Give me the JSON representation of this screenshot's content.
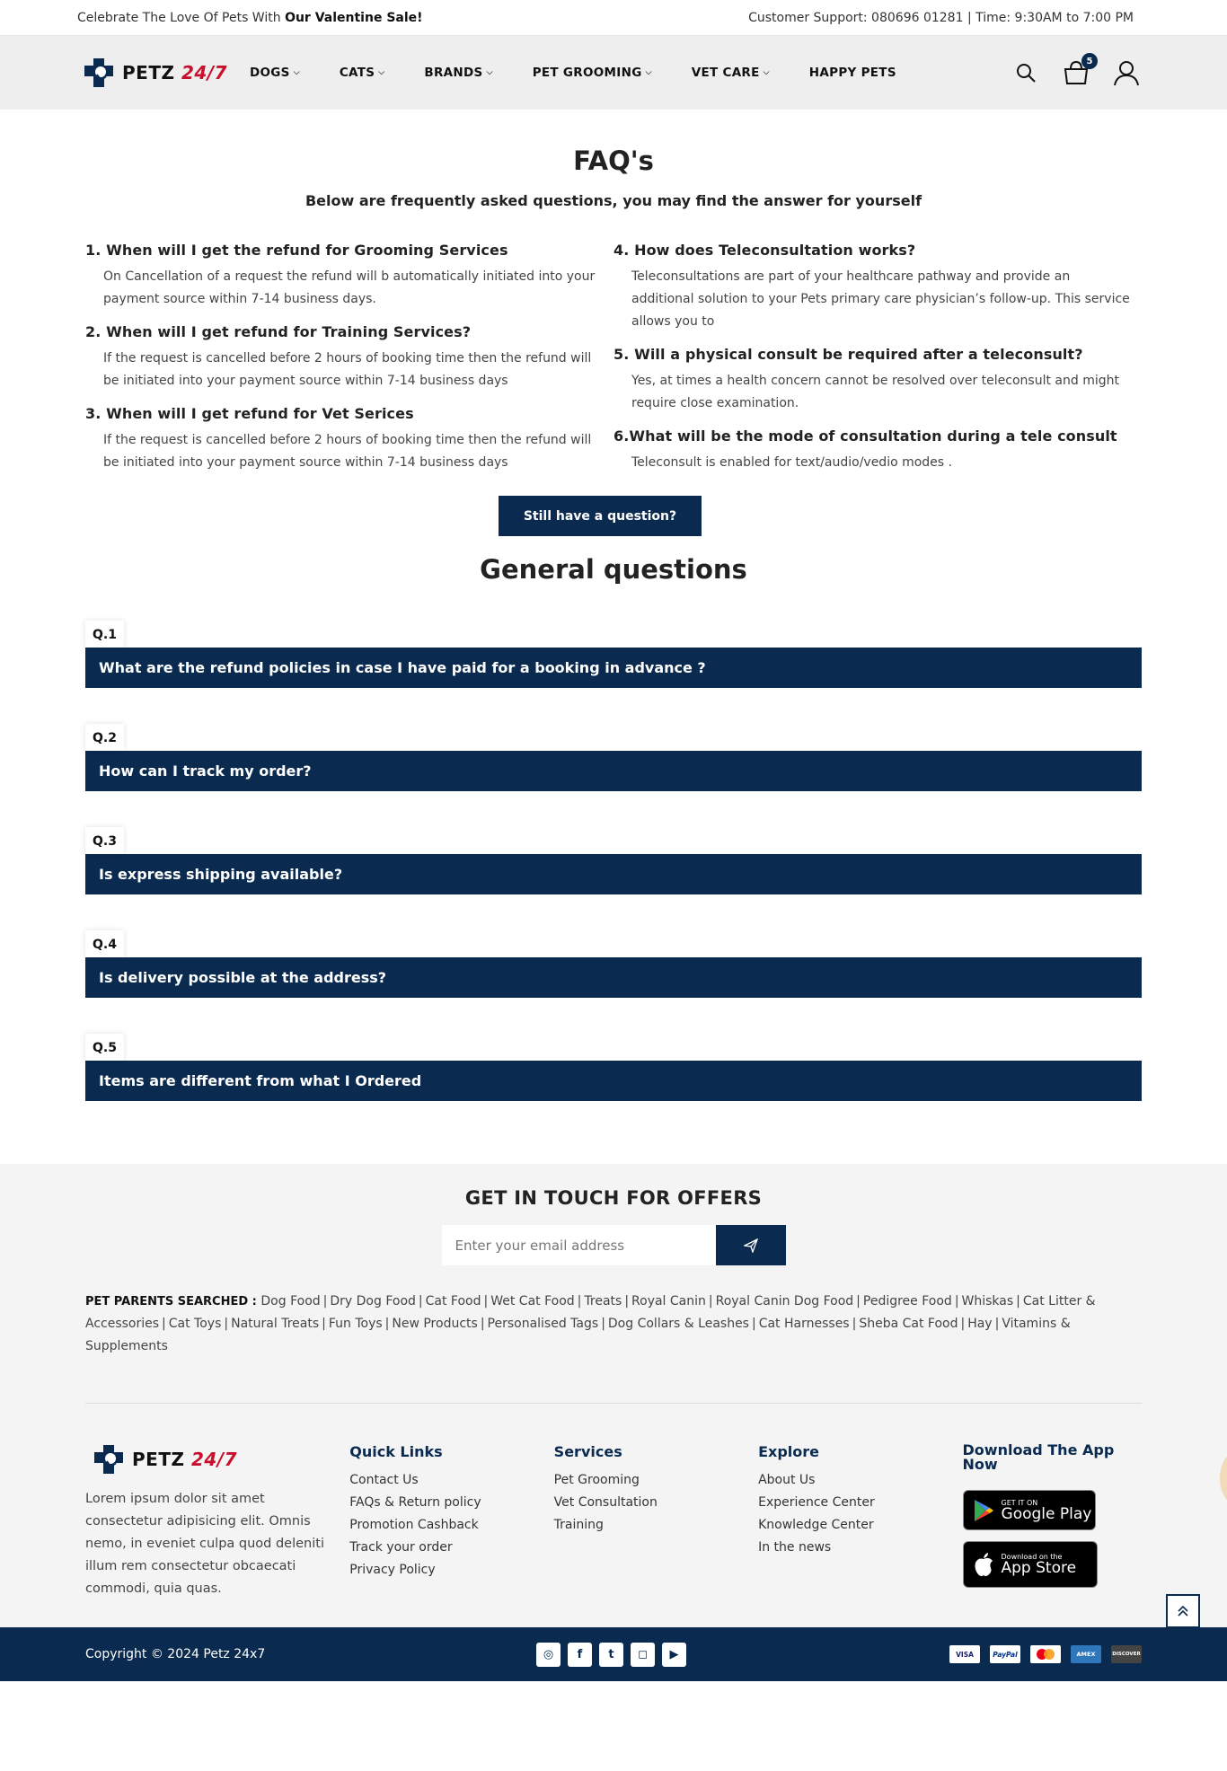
{
  "topbar": {
    "promo_prefix": "Celebrate The Love Of Pets With ",
    "promo_bold": "Our Valentine Sale!",
    "support": "Customer Support: 080696 01281 | Time: 9:30AM to 7:00 PM"
  },
  "logo": {
    "text": "PETZ ",
    "accent": "24/7"
  },
  "nav": [
    {
      "label": "DOGS",
      "dropdown": true
    },
    {
      "label": "CATS",
      "dropdown": true
    },
    {
      "label": "BRANDS",
      "dropdown": true
    },
    {
      "label": "PET GROOMING",
      "dropdown": true
    },
    {
      "label": "VET CARE",
      "dropdown": true
    },
    {
      "label": "HAPPY PETS",
      "dropdown": false
    }
  ],
  "cart": {
    "count": "5"
  },
  "faq": {
    "title": "FAQ's",
    "subtitle": "Below are frequently asked questions, you may find the answer for yourself",
    "left": [
      {
        "q": "1. When will I get the refund for Grooming Services",
        "a": "On Cancellation of a request the refund will b automatically initiated into your payment source within 7-14 business days."
      },
      {
        "q": "2. When will I get refund for Training Services?",
        "a": "If the request is cancelled before 2 hours of booking time then the refund will be initiated into your payment source within 7-14 business days"
      },
      {
        "q": "3. When will I get refund for Vet Serices",
        "a": "If the request is cancelled before 2 hours of booking time then the refund will be initiated into your payment source within 7-14 business days"
      }
    ],
    "right": [
      {
        "q": "4. How does Teleconsultation works?",
        "a": "Teleconsultations are part of your healthcare pathway and provide an additional solution to your Pets primary care physician’s follow-up. This service allows you to"
      },
      {
        "q": "5. Will a physical consult be required after a teleconsult?",
        "a": "Yes, at times a health concern cannot be resolved over teleconsult and might require close examination."
      },
      {
        "q": "6.What will be the mode of consultation during a tele consult",
        "a": "Teleconsult is enabled for text/audio/vedio modes ."
      }
    ],
    "still_button": "Still have a question?"
  },
  "general": {
    "title": "General questions",
    "items": [
      {
        "num": "Q.1",
        "q": "What are the refund policies in case I have paid for a booking in advance ?"
      },
      {
        "num": "Q.2",
        "q": "How can I track my order?"
      },
      {
        "num": "Q.3",
        "q": "Is express shipping available?"
      },
      {
        "num": "Q.4",
        "q": "Is delivery possible at the address?"
      },
      {
        "num": "Q.5",
        "q": "Items are different from what I Ordered"
      }
    ]
  },
  "newsletter": {
    "title": "GET IN TOUCH FOR OFFERS",
    "placeholder": "Enter your email address"
  },
  "searched": {
    "label": "PET PARENTS SEARCHED : ",
    "links": [
      "Dog Food",
      "Dry Dog Food",
      "Cat Food",
      "Wet Cat Food",
      "Treats",
      "Royal Canin",
      "Royal Canin Dog Food",
      "Pedigree Food",
      "Whiskas",
      "Cat Litter & Accessories",
      "Cat Toys",
      "Natural Treats",
      "Fun Toys",
      "New Products",
      "Personalised Tags",
      "Dog Collars & Leashes",
      "Cat Harnesses",
      "Sheba Cat Food",
      "Hay",
      "Vitamins & Supplements"
    ]
  },
  "footer": {
    "about": "Lorem ipsum dolor sit amet consectetur adipisicing elit. Omnis nemo, in eveniet culpa quod deleniti illum rem consectetur obcaecati commodi, quia quas.",
    "quick_links": {
      "title": "Quick Links",
      "items": [
        "Contact Us",
        "FAQs & Return policy",
        "Promotion Cashback",
        "Track your order",
        "Privacy Policy"
      ]
    },
    "services": {
      "title": "Services",
      "items": [
        "Pet Grooming",
        "Vet Consultation",
        "Training"
      ]
    },
    "explore": {
      "title": "Explore",
      "items": [
        "About Us",
        "Experience Center",
        "Knowledge Center",
        "In the news"
      ]
    },
    "app": {
      "title": "Download The App Now",
      "google_small": "GET IT ON",
      "google_big": "Google Play",
      "apple_small": "Download on the",
      "apple_big": "App Store"
    }
  },
  "bottom": {
    "copyright": "Copyright © 2024 Petz 24x7",
    "payments": [
      "VISA",
      "PayPal",
      "MC",
      "AMEX",
      "DISCOVER"
    ]
  },
  "colors": {
    "brand": "#0a2a4f",
    "accent": "#c8102e"
  }
}
